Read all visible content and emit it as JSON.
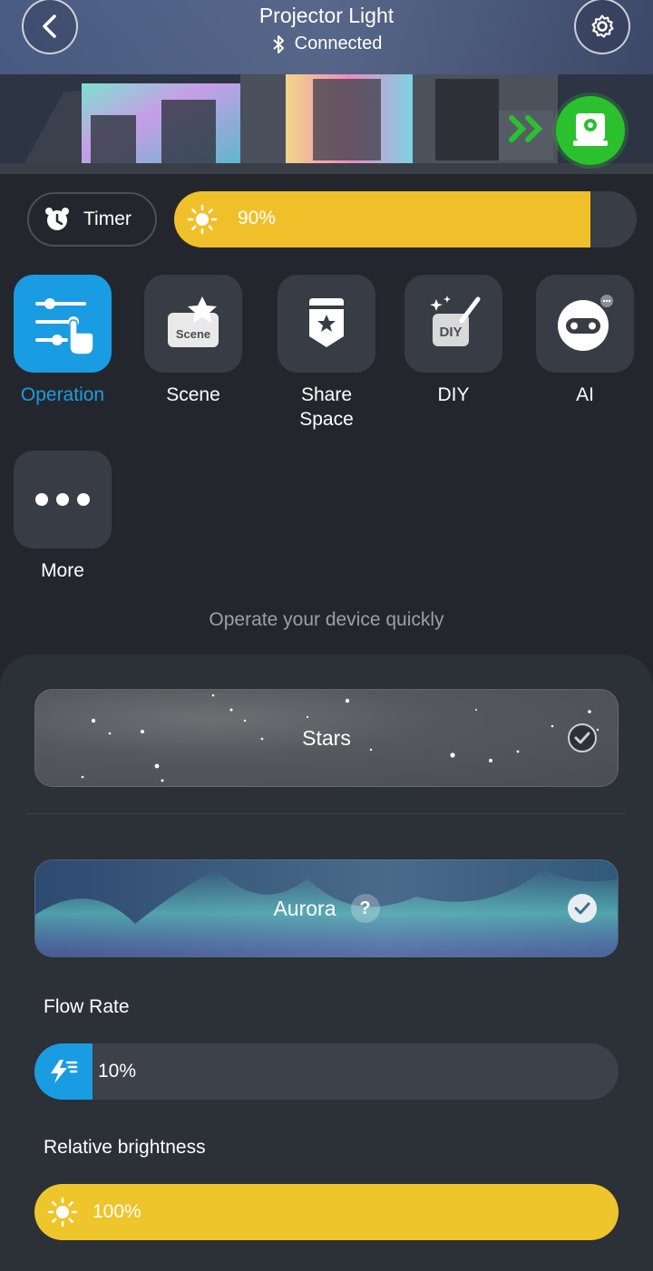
{
  "header": {
    "title": "Projector Light",
    "status": "Connected",
    "icons": {
      "back": "chevron-left-icon",
      "settings": "gear-icon",
      "bluetooth": "bluetooth-icon",
      "device": "projector-icon"
    }
  },
  "controls": {
    "timer_label": "Timer",
    "brightness": {
      "label": "90%",
      "value": 0.9
    }
  },
  "functions": [
    {
      "label": "Operation",
      "icon": "sliders-icon",
      "active": true
    },
    {
      "label": "Scene",
      "icon": "scene-icon",
      "active": false
    },
    {
      "label": "Share Space",
      "icon": "share-space-icon",
      "active": false
    },
    {
      "label": "DIY",
      "icon": "diy-icon",
      "active": false
    },
    {
      "label": "AI",
      "icon": "ai-robot-icon",
      "active": false
    },
    {
      "label": "More",
      "icon": "more-icon",
      "active": false
    }
  ],
  "hint": "Operate your device quickly",
  "modes": {
    "stars": {
      "label": "Stars",
      "selected": true
    },
    "aurora": {
      "label": "Aurora",
      "help": "?",
      "selected": true
    }
  },
  "flow_rate": {
    "title": "Flow Rate",
    "label": "10%",
    "value": 0.1
  },
  "relative_brightness": {
    "title": "Relative brightness",
    "label": "100%",
    "value": 1.0
  },
  "colors": {
    "accent": "#1a9ce3",
    "brightness": "#f0c02a",
    "device": "#2bc12e"
  }
}
